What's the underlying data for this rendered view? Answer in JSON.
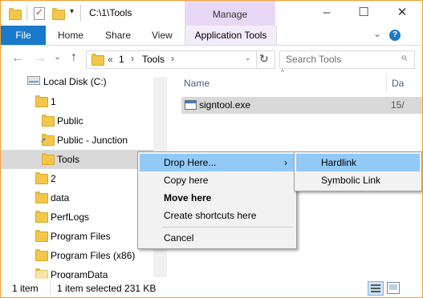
{
  "title_bar": {
    "path_title": "C:\\1\\Tools",
    "manage_label": "Manage",
    "minimize": "–",
    "maximize": "☐",
    "close": "✕"
  },
  "ribbon": {
    "file": "File",
    "home": "Home",
    "share": "Share",
    "view": "View",
    "app_tools": "Application Tools",
    "expand": "⌄",
    "help": "?"
  },
  "address": {
    "back": "←",
    "forward": "→",
    "dropdown": "⌄",
    "up": "↑",
    "overflow": "«",
    "crumb1": "1",
    "sep1": "›",
    "crumb2": "Tools",
    "sep2": "›",
    "refresh": "↻",
    "search_placeholder": "Search Tools",
    "search_icon": "⌕"
  },
  "nav_pane": {
    "drive": "Local Disk (C:)",
    "items": [
      "1",
      "Public",
      "Public - Junction",
      "Tools",
      "2",
      "data",
      "PerfLogs",
      "Program Files",
      "Program Files (x86)",
      "ProgramData"
    ]
  },
  "file_list": {
    "col_name": "Name",
    "col_date": "Da",
    "file_name": "signtool.exe",
    "file_date": "15/"
  },
  "context_menu": {
    "items": [
      "Drop Here...",
      "Copy here",
      "Move here",
      "Create shortcuts here",
      "Cancel"
    ],
    "submenu_arrow": "›"
  },
  "submenu": {
    "items": [
      "Hardlink",
      "Symbolic Link"
    ]
  },
  "status": {
    "count": "1 item",
    "selected": "1 item selected  231 KB"
  }
}
